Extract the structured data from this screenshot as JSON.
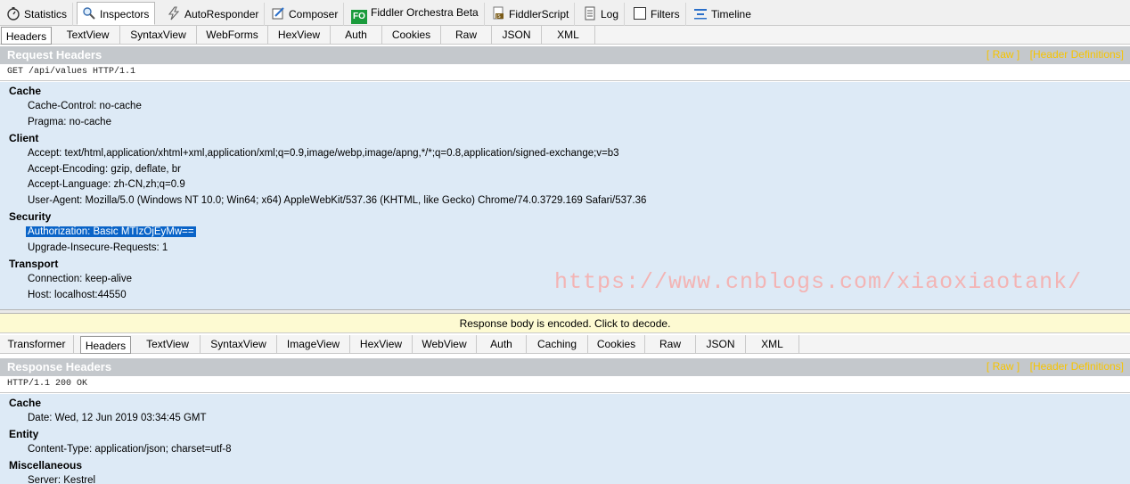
{
  "main_tabs": [
    {
      "label": "Statistics",
      "icon": "stopwatch-icon"
    },
    {
      "label": "Inspectors",
      "icon": "magnifier-icon"
    },
    {
      "label": "AutoResponder",
      "icon": "lightning-icon"
    },
    {
      "label": "Composer",
      "icon": "pencil-icon"
    },
    {
      "label": "Fiddler Orchestra Beta",
      "icon": "fo-icon",
      "icon_text": "FO"
    },
    {
      "label": "FiddlerScript",
      "icon": "script-icon"
    },
    {
      "label": "Log",
      "icon": "log-icon"
    },
    {
      "label": "Filters",
      "icon": "checkbox-icon"
    },
    {
      "label": "Timeline",
      "icon": "timeline-icon"
    }
  ],
  "request_tabs": [
    "Headers",
    "TextView",
    "SyntaxView",
    "WebForms",
    "HexView",
    "Auth",
    "Cookies",
    "Raw",
    "JSON",
    "XML"
  ],
  "request": {
    "title": "Request Headers",
    "link_raw": "[ Raw ]",
    "link_defs": "[Header Definitions]",
    "status_line": "GET /api/values HTTP/1.1",
    "groups": [
      {
        "name": "Cache",
        "items": [
          "Cache-Control: no-cache",
          "Pragma: no-cache"
        ]
      },
      {
        "name": "Client",
        "items": [
          "Accept: text/html,application/xhtml+xml,application/xml;q=0.9,image/webp,image/apng,*/*;q=0.8,application/signed-exchange;v=b3",
          "Accept-Encoding: gzip, deflate, br",
          "Accept-Language: zh-CN,zh;q=0.9",
          "User-Agent: Mozilla/5.0 (Windows NT 10.0; Win64; x64) AppleWebKit/537.36 (KHTML, like Gecko) Chrome/74.0.3729.169 Safari/537.36"
        ]
      },
      {
        "name": "Security",
        "items": [
          "Authorization: Basic MTIzOjEyMw==",
          "Upgrade-Insecure-Requests: 1"
        ]
      },
      {
        "name": "Transport",
        "items": [
          "Connection: keep-alive",
          "Host: localhost:44550"
        ]
      }
    ]
  },
  "watermark": "https://www.cnblogs.com/xiaoxiaotank/",
  "notice": "Response body is encoded. Click to decode.",
  "response_tabs": [
    "Transformer",
    "Headers",
    "TextView",
    "SyntaxView",
    "ImageView",
    "HexView",
    "WebView",
    "Auth",
    "Caching",
    "Cookies",
    "Raw",
    "JSON",
    "XML"
  ],
  "response": {
    "title": "Response Headers",
    "link_raw": "[ Raw ]",
    "link_defs": "[Header Definitions]",
    "status_line": "HTTP/1.1 200 OK",
    "groups": [
      {
        "name": "Cache",
        "items": [
          "Date: Wed, 12 Jun 2019 03:34:45 GMT"
        ]
      },
      {
        "name": "Entity",
        "items": [
          "Content-Type: application/json; charset=utf-8"
        ]
      },
      {
        "name": "Miscellaneous",
        "items": [
          "Server: Kestrel"
        ]
      }
    ]
  },
  "colors": {
    "section_header_bg": "#c4c8cc",
    "link_color": "#f6c400",
    "tree_bg": "#ddeaf6",
    "selection_bg": "#0a64c8",
    "notice_bg": "#fdfad2",
    "watermark": "#f3b4b4"
  }
}
